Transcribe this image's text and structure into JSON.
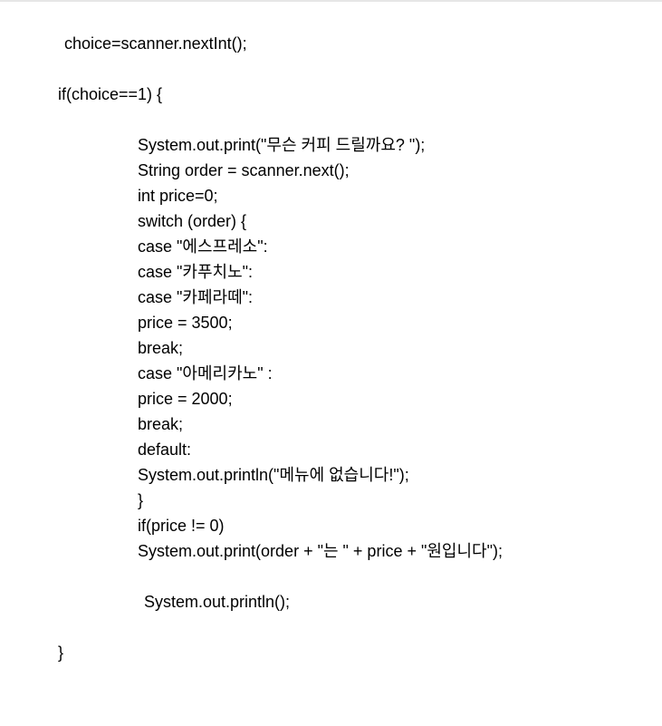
{
  "document": {
    "lines": [
      "choice=scanner.nextInt();",
      "if(choice==1) {",
      "System.out.print(\"무슨 커피 드릴까요? \");",
      "String order = scanner.next();",
      "int price=0;",
      "switch (order) {",
      "case \"에스프레소\":",
      "case \"카푸치노\":",
      "case \"카페라떼\":",
      "price = 3500;",
      "break;",
      "case \"아메리카노\" :",
      "price = 2000;",
      "break;",
      "default:",
      "System.out.println(\"메뉴에 없습니다!\");",
      "}",
      "if(price != 0)",
      "System.out.print(order + \"는 \" + price + \"원입니다\");",
      "System.out.println();",
      "}"
    ]
  }
}
